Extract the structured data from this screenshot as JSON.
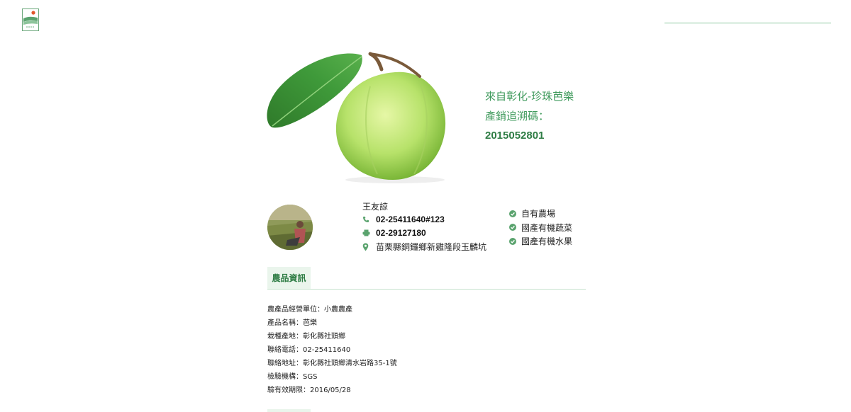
{
  "hero": {
    "line1": "來自彰化-珍珠芭樂",
    "line2": "產銷追溯碼：",
    "code": "2015052801"
  },
  "farmer": {
    "name": "王友諒",
    "phone": "02-25411640#123",
    "fax": "02-29127180",
    "address": "苗栗縣銅鑼鄉新雞隆段玉麟坑"
  },
  "certifications": [
    "自有農場",
    "國產有機蔬菜",
    "國產有機水果"
  ],
  "tab": {
    "label": "農品資訊"
  },
  "product_info": [
    "農產品經營單位：小農農產",
    "產品名稱：芭樂",
    "栽種產地：彰化縣社頭鄉",
    "聯絡電話：02-25411640",
    "聯絡地址：彰化縣社頭鄉清水岩路35-1號",
    "檢驗機構：SGS",
    "驗有效期限：2016/05/28"
  ],
  "colors": {
    "accent_green": "#3f9a5c",
    "dark_green": "#2f7d45",
    "tab_bg": "#eaf5ec"
  },
  "icons": {
    "phone": "phone-icon",
    "fax": "fax-icon",
    "address": "map-marker-icon",
    "cert": "check-circle-icon"
  }
}
